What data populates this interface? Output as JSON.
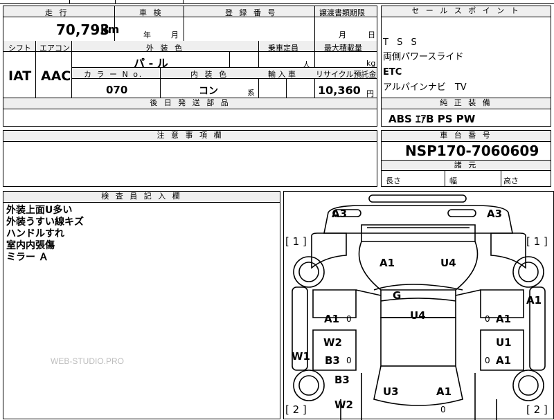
{
  "vehicle": {
    "mileage_label": "走 行",
    "mileage_value": "70,793",
    "mileage_unit": "km",
    "inspection_label": "車 検",
    "inspection_year": "年",
    "inspection_month": "月",
    "registration_label": "登 録 番 号",
    "transfer_label": "譲渡書類期限",
    "transfer_month": "月",
    "transfer_day": "日",
    "shift_label": "シフト",
    "shift_value": "IAT",
    "ac_label": "エアコン",
    "ac_value": "AAC",
    "exterior_color_label": "外 装 色",
    "exterior_color_value": "パ - ル",
    "capacity_label": "乗車定員",
    "capacity_unit": "人",
    "max_load_label": "最大積載量",
    "max_load_unit": "kg",
    "color_no_label": "カ ラ ー N o.",
    "color_no_value": "070",
    "interior_label": "内 装 色",
    "interior_value": "コン",
    "interior_suffix": "系",
    "import_label": "輸 入 車",
    "recycle_label": "リサイクル預託金",
    "recycle_value": "10,360",
    "recycle_unit": "円",
    "later_parts_label": "後 日 発 送 部 品"
  },
  "sales_points": {
    "header": "セ ー ル ス ポ イ ン ト",
    "items": [
      "T S S",
      "両側パワースライド",
      "ETC",
      "アルパインナビ　TV"
    ]
  },
  "equipment": {
    "header": "純 正 装 備",
    "value": "ABS  ｴｱB  PS  PW"
  },
  "caution": {
    "header": "注 意 事 項 欄"
  },
  "chassis": {
    "header": "車 台 番 号",
    "value": "NSP170-7060609",
    "dims_header": "諸 元",
    "length_label": "長さ",
    "width_label": "幅",
    "height_label": "高さ"
  },
  "inspector": {
    "header": "検 査 員 記 入 欄",
    "notes": [
      "外装上面U多い",
      "外装うすい線キズ",
      "ハンドルすれ",
      "室内内張傷",
      "ミラー Ａ"
    ]
  },
  "diagram": {
    "labels": {
      "a3_left": "A3",
      "a3_right": "A3",
      "b1_left": "[ 1 ]",
      "b1_right": "[ 1 ]",
      "a1_hood": "A1",
      "u4_hood": "U4",
      "g_windshield": "G",
      "u4_roof": "U4",
      "a1_right_side": "A1",
      "a1_left_front_door": "A1",
      "a1_right_front_door": "A1",
      "w2_left": "W2",
      "u1_right": "U1",
      "w1_left": "W1",
      "b3_left_door": "B3",
      "a1_right_rear_door": "A1",
      "b3_rear_left": "B3",
      "w2_rear_left": "W2",
      "u3_rear": "U3",
      "a1_rear": "A1",
      "b2_left": "[ 2 ]",
      "b2_right": "[ 2 ]",
      "small_0_1": "0",
      "small_0_2": "0",
      "small_0_3": "0",
      "small_0_4": "0",
      "small_0_5": "0"
    }
  },
  "watermark": "WEB-STUDIO.PRO"
}
